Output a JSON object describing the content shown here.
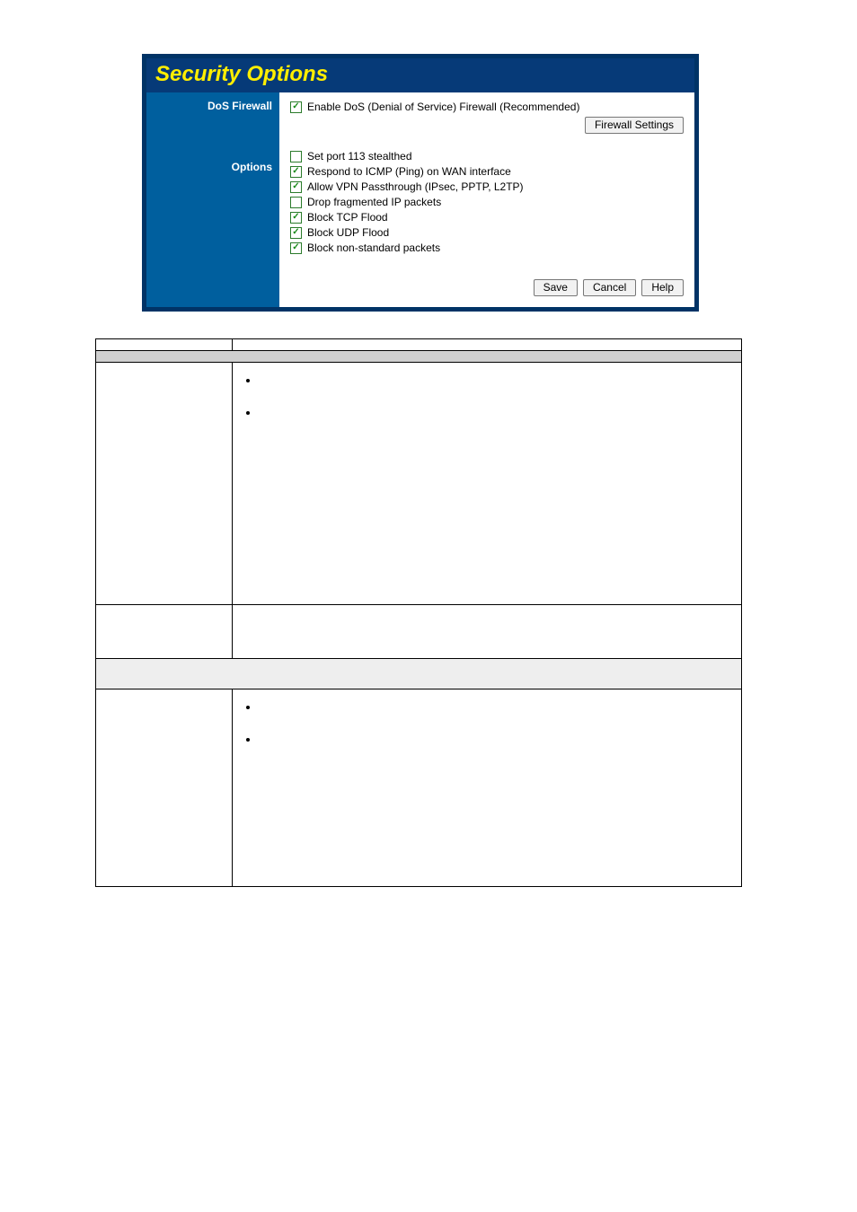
{
  "panel": {
    "title": "Security Options",
    "side": {
      "dos_label": "DoS Firewall",
      "options_label": "Options"
    },
    "dos": {
      "enable_label": "Enable DoS (Denial of Service) Firewall (Recommended)",
      "firewall_settings_btn": "Firewall Settings"
    },
    "options": [
      {
        "checked": false,
        "label": "Set port 113 stealthed"
      },
      {
        "checked": true,
        "label": "Respond to ICMP (Ping) on WAN interface"
      },
      {
        "checked": true,
        "label": "Allow VPN Passthrough (IPsec, PPTP, L2TP)"
      },
      {
        "checked": false,
        "label": "Drop fragmented IP packets"
      },
      {
        "checked": true,
        "label": "Block TCP Flood"
      },
      {
        "checked": true,
        "label": "Block UDP Flood"
      },
      {
        "checked": true,
        "label": "Block non-standard packets"
      }
    ],
    "buttons": {
      "save": "Save",
      "cancel": "Cancel",
      "help": "Help"
    }
  },
  "table": {
    "col_setting": "",
    "col_desc": "",
    "section_firewall": "",
    "row_enable_label": "",
    "row_enable_desc": "",
    "row_enable_bullet1": "",
    "row_enable_bullet2": "",
    "row_firewall_settings_label": "",
    "row_firewall_settings_desc": "",
    "section_options": "",
    "row_respond_icmp_label": "",
    "row_respond_icmp_desc": "",
    "row_respond_icmp_bullet1": "",
    "row_respond_icmp_bullet2": ""
  }
}
